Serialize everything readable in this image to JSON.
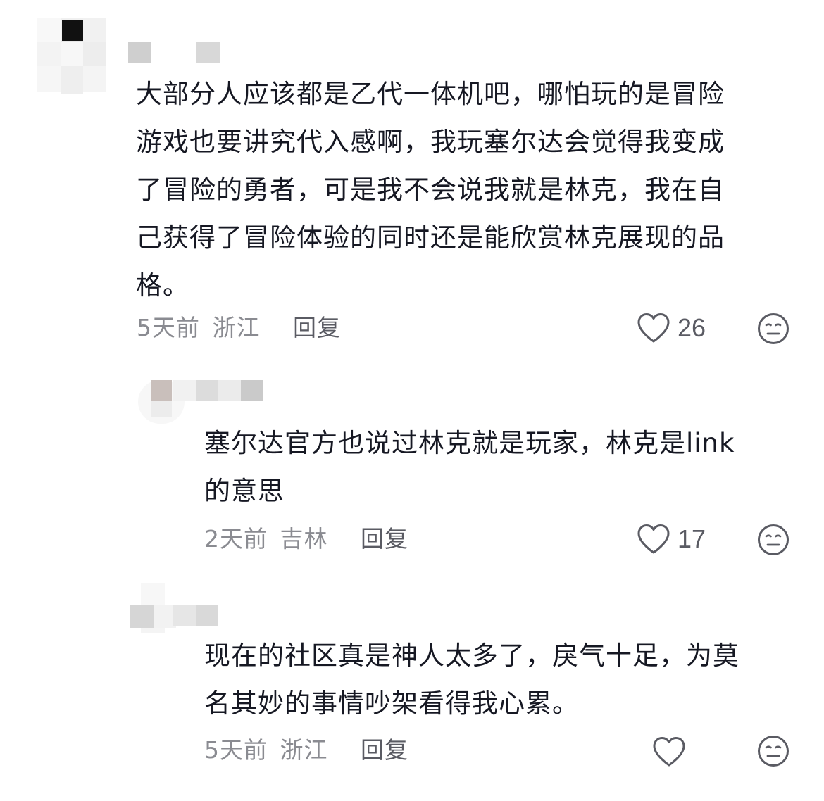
{
  "comments": [
    {
      "text_lines": [
        "大部分人应该都是乙代一体机吧，哪怕玩的是冒险",
        "游戏也要讲究代入感啊，我玩塞尔达会觉得我变成",
        "了冒险的勇者，可是我不会说我就是林克，我在自",
        "己获得了冒险体验的同时还是能欣赏林克展现的品",
        "格。"
      ],
      "time": "5天前",
      "location": "浙江",
      "reply_label": "回复",
      "like_count": "26",
      "like_icon": "heart-outline-icon",
      "dislike_icon": "meh-face-icon"
    },
    {
      "text_lines": [
        "塞尔达官方也说过林克就是玩家，林克是link",
        "的意思"
      ],
      "time": "2天前",
      "location": "吉林",
      "reply_label": "回复",
      "like_count": "17",
      "like_icon": "heart-outline-icon",
      "dislike_icon": "meh-face-icon"
    },
    {
      "text_lines": [
        "现在的社区真是神人太多了，戾气十足，为莫",
        "名其妙的事情吵架看得我心累。"
      ],
      "time": "5天前",
      "location": "浙江",
      "reply_label": "回复",
      "like_count": "",
      "like_icon": "heart-outline-icon",
      "dislike_icon": "meh-face-icon"
    }
  ]
}
